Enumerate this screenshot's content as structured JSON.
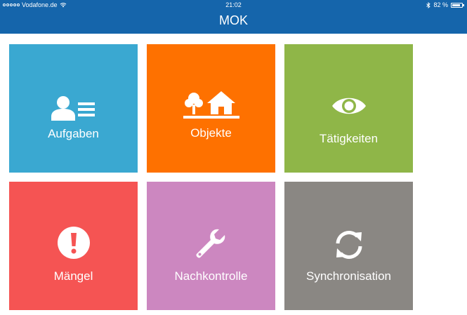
{
  "status_bar": {
    "carrier": "Vodafone.de",
    "time": "21:02",
    "battery": "82 %",
    "battery_level": 0.82
  },
  "nav": {
    "title": "MOK"
  },
  "tiles": [
    {
      "label": "Aufgaben",
      "icon": "user-list-icon",
      "color": "#3aa8d1"
    },
    {
      "label": "Objekte",
      "icon": "tree-house-icon",
      "color": "#fe7100"
    },
    {
      "label": "Tätigkeiten",
      "icon": "eye-icon",
      "color": "#8fb648"
    },
    {
      "label": "Mängel",
      "icon": "exclamation-icon",
      "color": "#f55453"
    },
    {
      "label": "Nachkontrolle",
      "icon": "wrench-icon",
      "color": "#cc87c0"
    },
    {
      "label": "Synchronisation",
      "icon": "sync-icon",
      "color": "#8a8783"
    }
  ]
}
